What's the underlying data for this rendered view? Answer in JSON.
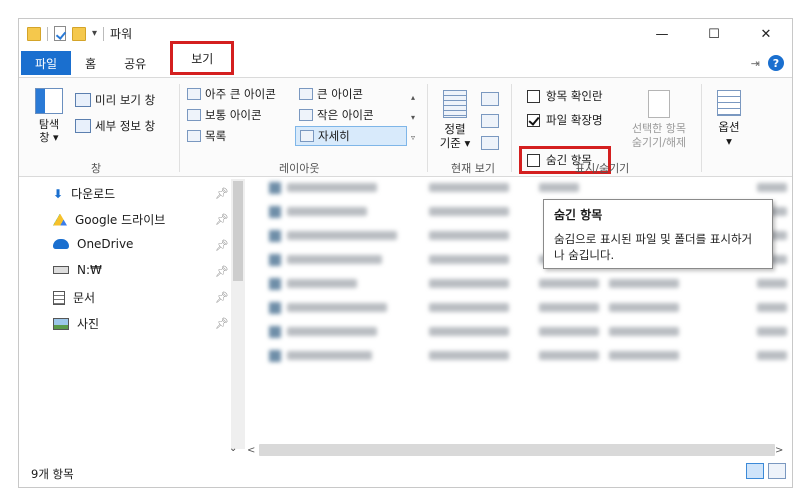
{
  "window": {
    "title": "파워"
  },
  "titlebar": {
    "minimize": "—",
    "maximize": "☐",
    "close": "✕"
  },
  "tabs": {
    "file": "파일",
    "home": "홈",
    "share": "공유",
    "view": "보기"
  },
  "ribbon": {
    "pane": {
      "nav_pane": "탐색\n창 ▾",
      "preview_pane": "미리 보기 창",
      "details_pane": "세부 정보 창",
      "label": "창"
    },
    "layout": {
      "extra_large_icons": "아주 큰 아이콘",
      "large_icons": "큰 아이콘",
      "medium_icons": "보통 아이콘",
      "small_icons": "작은 아이콘",
      "list": "목록",
      "details": "자세히",
      "label": "레이아웃"
    },
    "current_view": {
      "sort_by": "정렬\n기준 ▾",
      "label": "현재 보기"
    },
    "show_hide": {
      "item_check_boxes": "항목 확인란",
      "file_name_extensions": "파일 확장명",
      "hidden_items": "숨긴 항목",
      "hide_selected": "선택한 항목\n숨기기/해제",
      "label": "표시/숨기기"
    },
    "options": {
      "label": "옵션\n▾"
    }
  },
  "nav": {
    "items": [
      {
        "label": "다운로드"
      },
      {
        "label": "Google 드라이브"
      },
      {
        "label": "OneDrive"
      },
      {
        "label": "N:₩"
      },
      {
        "label": "문서"
      },
      {
        "label": "사진"
      }
    ]
  },
  "tooltip": {
    "title": "숨긴 항목",
    "body": "숨김으로 표시된 파일 및 폴더를 표시하거나 숨깁니다."
  },
  "status": {
    "item_count": "9개 항목"
  },
  "colors": {
    "accent": "#1a6fcf",
    "highlight": "#d41f1f"
  }
}
